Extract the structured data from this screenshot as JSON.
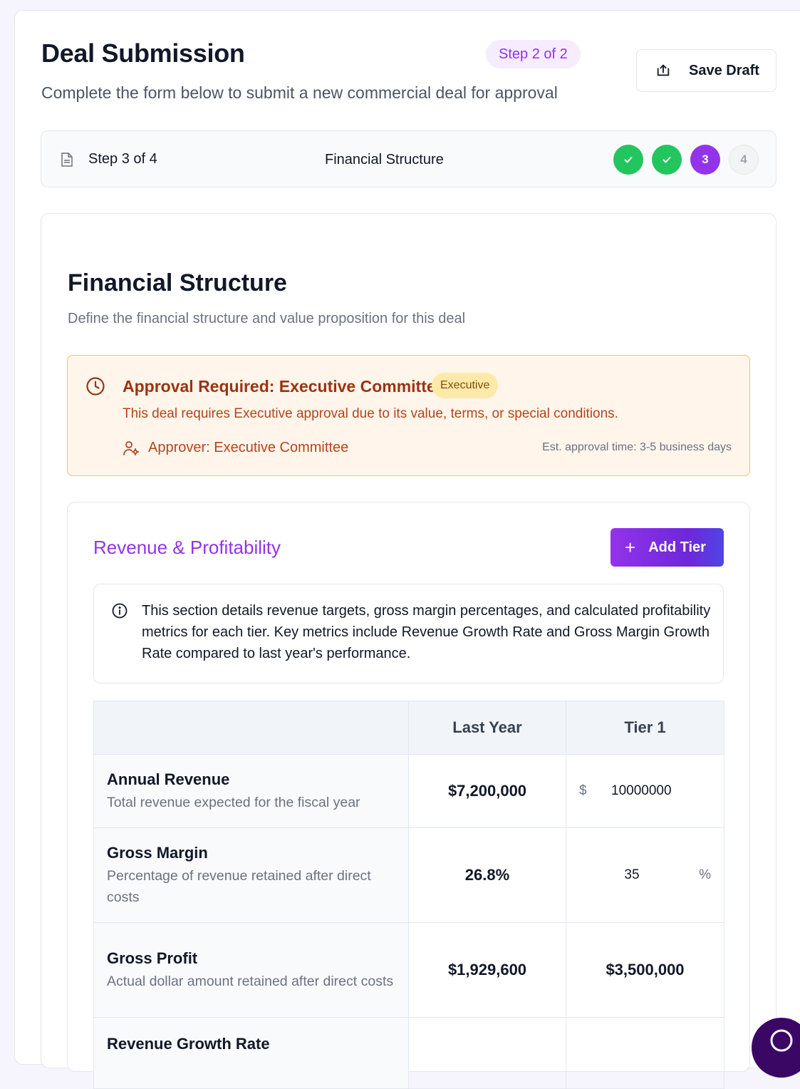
{
  "header": {
    "title": "Deal Submission",
    "subtitle": "Complete the form below to submit a new commercial deal for approval",
    "step_pill": "Step 2 of 2",
    "save_label": "Save Draft"
  },
  "progress": {
    "step_text": "Step 3 of 4",
    "current_name": "Financial Structure",
    "dots": [
      {
        "state": "done",
        "label": ""
      },
      {
        "state": "done",
        "label": ""
      },
      {
        "state": "active",
        "label": "3"
      },
      {
        "state": "todo",
        "label": "4"
      }
    ]
  },
  "section": {
    "title": "Financial Structure",
    "subtitle": "Define the financial structure and value proposition for this deal"
  },
  "alert": {
    "title": "Approval Required: Executive Committee",
    "badge": "Executive",
    "text": "This deal requires Executive approval due to its value, terms, or special conditions.",
    "approver": "Approver: Executive Committee",
    "est": "Est. approval time: 3-5 business days"
  },
  "revenue": {
    "title": "Revenue & Profitability",
    "add_tier": "Add Tier",
    "info": "This section details revenue targets, gross margin percentages, and calculated profitability metrics for each tier. Key metrics include Revenue Growth Rate and Gross Margin Growth Rate compared to last year's performance."
  },
  "table": {
    "headers": [
      "",
      "Last Year",
      "Tier 1"
    ],
    "rows": [
      {
        "name": "Annual Revenue",
        "desc": "Total revenue expected for the fiscal year",
        "last_year": "$7,200,000",
        "currency": "$",
        "tier1": "10000000"
      },
      {
        "name": "Gross Margin",
        "desc": "Percentage of revenue retained after direct costs",
        "last_year": "26.8%",
        "tier1": "35",
        "unit": "%"
      },
      {
        "name": "Gross Profit",
        "desc": "Actual dollar amount retained after direct costs",
        "last_year": "$1,929,600",
        "tier1": "$3,500,000"
      },
      {
        "name": "Revenue Growth Rate",
        "desc": "",
        "last_year": "",
        "tier1": ""
      }
    ]
  },
  "colors": {
    "accent": "#9333ea",
    "success": "#22c55e",
    "warning_bg": "#fff5eb",
    "warning_text": "#9a3412"
  },
  "icons": [
    "upload-icon",
    "document-icon",
    "check-icon",
    "clock-icon",
    "user-settings-icon",
    "plus-icon",
    "info-icon",
    "chat-icon"
  ]
}
